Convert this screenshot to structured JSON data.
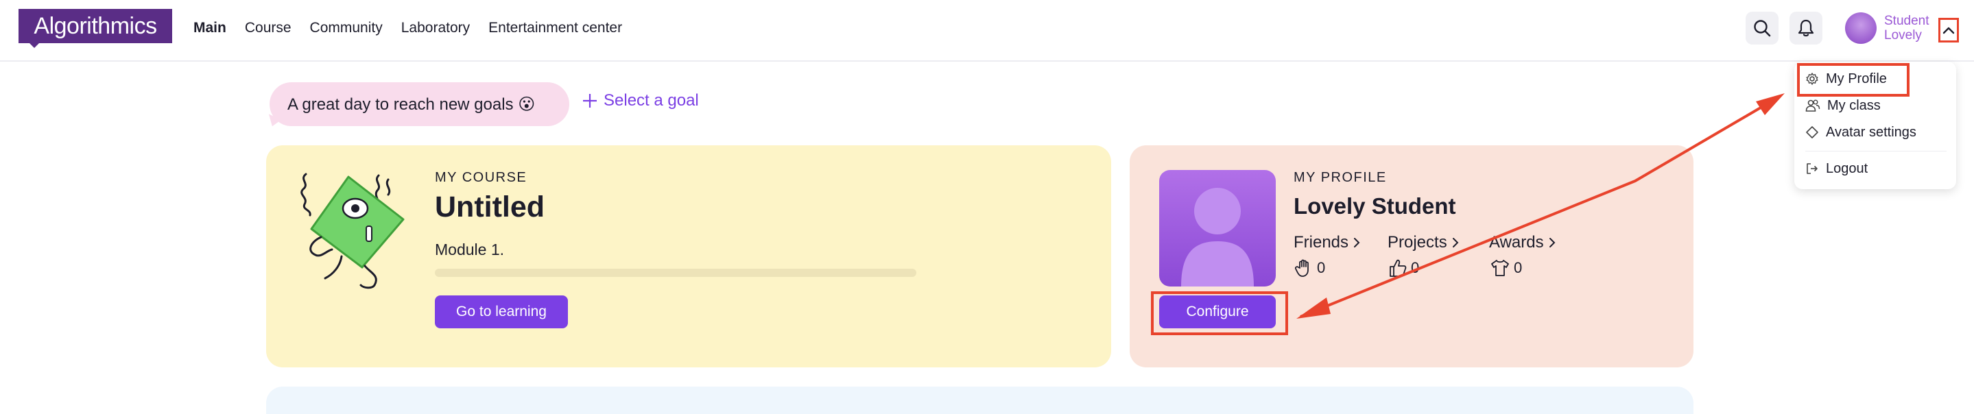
{
  "header": {
    "logo": "Algorithmics",
    "nav": [
      "Main",
      "Course",
      "Community",
      "Laboratory",
      "Entertainment center"
    ],
    "user_first": "Student",
    "user_last": "Lovely"
  },
  "dropdown": {
    "items": [
      "My Profile",
      "My class",
      "Avatar settings",
      "Logout"
    ]
  },
  "goal": {
    "message": "A great day to reach new goals 😮",
    "select_label": "Select a goal"
  },
  "course": {
    "eyebrow": "MY COURSE",
    "title": "Untitled",
    "module": "Module 1.",
    "progress": 0,
    "button": "Go to learning"
  },
  "profile": {
    "eyebrow": "MY PROFILE",
    "name": "Lovely Student",
    "stats": [
      {
        "label": "Friends",
        "value": "0",
        "icon": "hand-icon"
      },
      {
        "label": "Projects",
        "value": "0",
        "icon": "thumbs-up-icon"
      },
      {
        "label": "Awards",
        "value": "0",
        "icon": "shirt-icon"
      }
    ],
    "button": "Configure"
  },
  "colors": {
    "brand": "#5a2d86",
    "accent": "#7b3fe4",
    "annotation": "#e8432c",
    "course_card": "#fdf4c7",
    "profile_card": "#fae3da"
  }
}
